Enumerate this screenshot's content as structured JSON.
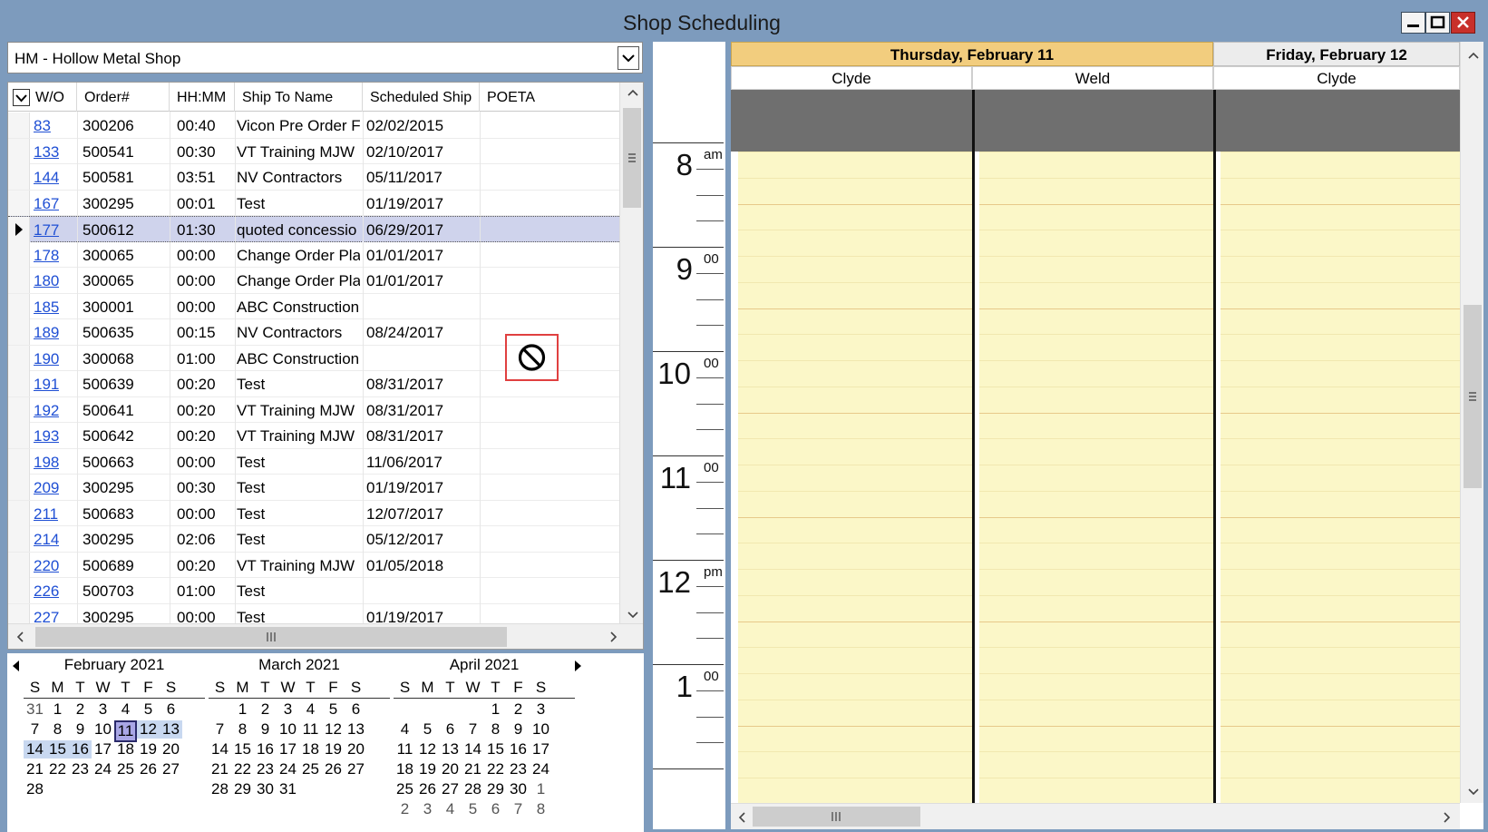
{
  "window": {
    "title": "Shop Scheduling"
  },
  "shop_select": {
    "value": "HM - Hollow Metal Shop"
  },
  "grid": {
    "columns": [
      "W/O",
      "Order#",
      "HH:MM",
      "Ship To Name",
      "Scheduled Ship",
      "POETA"
    ],
    "rows": [
      {
        "wo": "83",
        "order": "300206",
        "hhmm": "00:40",
        "ship_to": "Vicon Pre Order F",
        "sched": "02/02/2015",
        "poeta": ""
      },
      {
        "wo": "133",
        "order": "500541",
        "hhmm": "00:30",
        "ship_to": "VT Training MJW",
        "sched": "02/10/2017",
        "poeta": ""
      },
      {
        "wo": "144",
        "order": "500581",
        "hhmm": "03:51",
        "ship_to": "NV Contractors",
        "sched": "05/11/2017",
        "poeta": ""
      },
      {
        "wo": "167",
        "order": "300295",
        "hhmm": "00:01",
        "ship_to": "Test",
        "sched": "01/19/2017",
        "poeta": ""
      },
      {
        "wo": "177",
        "order": "500612",
        "hhmm": "01:30",
        "ship_to": "quoted concessio",
        "sched": "06/29/2017",
        "poeta": "",
        "selected": true
      },
      {
        "wo": "178",
        "order": "300065",
        "hhmm": "00:00",
        "ship_to": "Change Order Pla",
        "sched": "01/01/2017",
        "poeta": ""
      },
      {
        "wo": "180",
        "order": "300065",
        "hhmm": "00:00",
        "ship_to": "Change Order Pla",
        "sched": "01/01/2017",
        "poeta": ""
      },
      {
        "wo": "185",
        "order": "300001",
        "hhmm": "00:00",
        "ship_to": "ABC Construction",
        "sched": "",
        "poeta": ""
      },
      {
        "wo": "189",
        "order": "500635",
        "hhmm": "00:15",
        "ship_to": "NV Contractors",
        "sched": "08/24/2017",
        "poeta": ""
      },
      {
        "wo": "190",
        "order": "300068",
        "hhmm": "01:00",
        "ship_to": "ABC Construction",
        "sched": "",
        "poeta": ""
      },
      {
        "wo": "191",
        "order": "500639",
        "hhmm": "00:20",
        "ship_to": "Test",
        "sched": "08/31/2017",
        "poeta": ""
      },
      {
        "wo": "192",
        "order": "500641",
        "hhmm": "00:20",
        "ship_to": "VT Training MJW",
        "sched": "08/31/2017",
        "poeta": ""
      },
      {
        "wo": "193",
        "order": "500642",
        "hhmm": "00:20",
        "ship_to": "VT Training MJW",
        "sched": "08/31/2017",
        "poeta": ""
      },
      {
        "wo": "198",
        "order": "500663",
        "hhmm": "00:00",
        "ship_to": "Test",
        "sched": "11/06/2017",
        "poeta": ""
      },
      {
        "wo": "209",
        "order": "300295",
        "hhmm": "00:30",
        "ship_to": "Test",
        "sched": "01/19/2017",
        "poeta": ""
      },
      {
        "wo": "211",
        "order": "500683",
        "hhmm": "00:00",
        "ship_to": "Test",
        "sched": "12/07/2017",
        "poeta": ""
      },
      {
        "wo": "214",
        "order": "300295",
        "hhmm": "02:06",
        "ship_to": "Test",
        "sched": "05/12/2017",
        "poeta": ""
      },
      {
        "wo": "220",
        "order": "500689",
        "hhmm": "00:20",
        "ship_to": "VT Training MJW",
        "sched": "01/05/2018",
        "poeta": ""
      },
      {
        "wo": "226",
        "order": "500703",
        "hhmm": "01:00",
        "ship_to": "Test",
        "sched": "",
        "poeta": ""
      },
      {
        "wo": "227",
        "order": "300295",
        "hhmm": "00:00",
        "ship_to": "Test",
        "sched": "01/19/2017",
        "poeta": ""
      }
    ]
  },
  "calendars": {
    "dow": [
      "S",
      "M",
      "T",
      "W",
      "T",
      "F",
      "S"
    ],
    "months": [
      {
        "title": "February 2021",
        "weeks": [
          [
            {
              "d": "31",
              "o": true
            },
            {
              "d": "1"
            },
            {
              "d": "2"
            },
            {
              "d": "3"
            },
            {
              "d": "4"
            },
            {
              "d": "5"
            },
            {
              "d": "6"
            }
          ],
          [
            {
              "d": "7"
            },
            {
              "d": "8"
            },
            {
              "d": "9"
            },
            {
              "d": "10"
            },
            {
              "d": "11",
              "today": true
            },
            {
              "d": "12",
              "hl": true
            },
            {
              "d": "13",
              "hl": true
            }
          ],
          [
            {
              "d": "14",
              "hl": true
            },
            {
              "d": "15",
              "hl": true
            },
            {
              "d": "16",
              "hl": true
            },
            {
              "d": "17"
            },
            {
              "d": "18"
            },
            {
              "d": "19"
            },
            {
              "d": "20"
            }
          ],
          [
            {
              "d": "21"
            },
            {
              "d": "22"
            },
            {
              "d": "23"
            },
            {
              "d": "24"
            },
            {
              "d": "25"
            },
            {
              "d": "26"
            },
            {
              "d": "27"
            }
          ],
          [
            {
              "d": "28"
            }
          ]
        ]
      },
      {
        "title": "March 2021",
        "weeks": [
          [
            {
              "d": ""
            },
            {
              "d": "1"
            },
            {
              "d": "2"
            },
            {
              "d": "3"
            },
            {
              "d": "4"
            },
            {
              "d": "5"
            },
            {
              "d": "6"
            }
          ],
          [
            {
              "d": "7"
            },
            {
              "d": "8"
            },
            {
              "d": "9"
            },
            {
              "d": "10"
            },
            {
              "d": "11"
            },
            {
              "d": "12"
            },
            {
              "d": "13"
            }
          ],
          [
            {
              "d": "14"
            },
            {
              "d": "15"
            },
            {
              "d": "16"
            },
            {
              "d": "17"
            },
            {
              "d": "18"
            },
            {
              "d": "19"
            },
            {
              "d": "20"
            }
          ],
          [
            {
              "d": "21"
            },
            {
              "d": "22"
            },
            {
              "d": "23"
            },
            {
              "d": "24"
            },
            {
              "d": "25"
            },
            {
              "d": "26"
            },
            {
              "d": "27"
            }
          ],
          [
            {
              "d": "28"
            },
            {
              "d": "29"
            },
            {
              "d": "30"
            },
            {
              "d": "31"
            }
          ]
        ]
      },
      {
        "title": "April 2021",
        "weeks": [
          [
            {
              "d": ""
            },
            {
              "d": ""
            },
            {
              "d": ""
            },
            {
              "d": ""
            },
            {
              "d": "1"
            },
            {
              "d": "2"
            },
            {
              "d": "3"
            }
          ],
          [
            {
              "d": "4"
            },
            {
              "d": "5"
            },
            {
              "d": "6"
            },
            {
              "d": "7"
            },
            {
              "d": "8"
            },
            {
              "d": "9"
            },
            {
              "d": "10"
            }
          ],
          [
            {
              "d": "11"
            },
            {
              "d": "12"
            },
            {
              "d": "13"
            },
            {
              "d": "14"
            },
            {
              "d": "15"
            },
            {
              "d": "16"
            },
            {
              "d": "17"
            }
          ],
          [
            {
              "d": "18"
            },
            {
              "d": "19"
            },
            {
              "d": "20"
            },
            {
              "d": "21"
            },
            {
              "d": "22"
            },
            {
              "d": "23"
            },
            {
              "d": "24"
            }
          ],
          [
            {
              "d": "25"
            },
            {
              "d": "26"
            },
            {
              "d": "27"
            },
            {
              "d": "28"
            },
            {
              "d": "29"
            },
            {
              "d": "30"
            },
            {
              "d": "1",
              "o": true
            }
          ],
          [
            {
              "d": "2",
              "o": true
            },
            {
              "d": "3",
              "o": true
            },
            {
              "d": "4",
              "o": true
            },
            {
              "d": "5",
              "o": true
            },
            {
              "d": "6",
              "o": true
            },
            {
              "d": "7",
              "o": true
            },
            {
              "d": "8",
              "o": true
            }
          ]
        ]
      }
    ]
  },
  "timeline": {
    "hours": [
      {
        "hour": "8",
        "suffix": "am"
      },
      {
        "hour": "9",
        "suffix": "00"
      },
      {
        "hour": "10",
        "suffix": "00"
      },
      {
        "hour": "11",
        "suffix": "00"
      },
      {
        "hour": "12",
        "suffix": "pm"
      },
      {
        "hour": "1",
        "suffix": "00"
      }
    ]
  },
  "schedule": {
    "days": [
      {
        "label": "Thursday, February 11",
        "active": true
      },
      {
        "label": "Friday, February 12",
        "active": false
      }
    ],
    "resources": [
      "Clyde",
      "Weld",
      "Clyde"
    ]
  },
  "icons": {
    "no_entry_cursor": "no-entry-icon",
    "scroll_grip": "grip-icon"
  },
  "colors": {
    "title_bar": "#7d9bbd",
    "active_day_header": "#f2cd7e",
    "schedule_cell": "#fbf7c8",
    "link": "#1f4fd4",
    "close_button": "#c8302a"
  }
}
